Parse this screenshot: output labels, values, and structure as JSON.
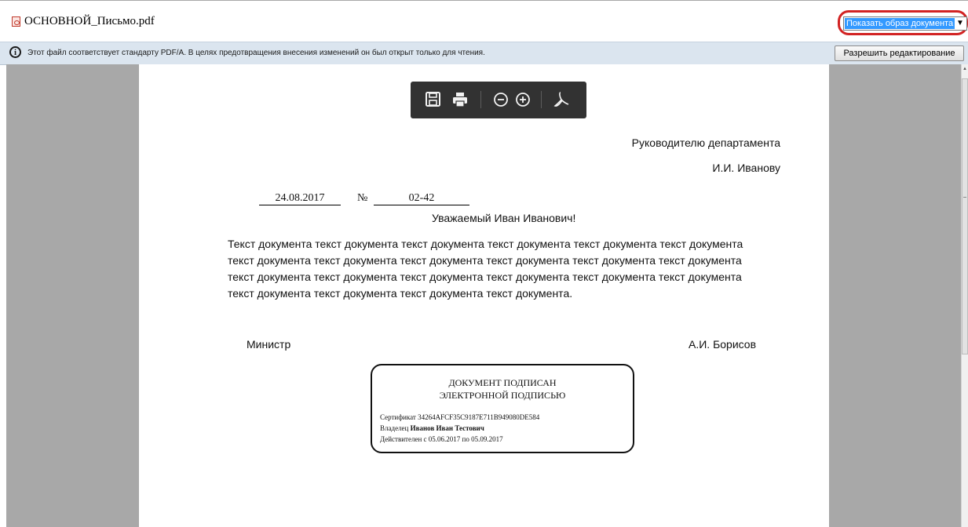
{
  "window": {
    "file_title": "ОСНОВНОЙ_Письмо.pdf",
    "view_mode_selected": "Показать образ документа"
  },
  "infobar": {
    "message": "Этот файл соответствует стандарту PDF/A. В целях предотвращения внесения изменений он был открыт только для чтения.",
    "enable_editing_label": "Разрешить редактирование"
  },
  "pdf_toolbar": {
    "buttons": [
      "save-icon",
      "print-icon",
      "zoom-out-icon",
      "zoom-in-icon",
      "acrobat-icon"
    ]
  },
  "document": {
    "addressee_line1": "Руководителю департамента",
    "addressee_line2": "И.И. Иванову",
    "reg_date": "24.08.2017",
    "reg_number_label": "№",
    "reg_number": "02-42",
    "greeting": "Уважаемый Иван Иванович!",
    "body_lines": [
      "Текст документа текст документа текст документа текст документа текст документа текст документа",
      "текст документа текст документа текст документа текст документа текст документа текст документа",
      "текст документа текст документа текст документа текст документа текст документа текст документа",
      "текст документа текст документа текст документа текст документа."
    ],
    "signer_position": "Министр",
    "signer_name": "А.И. Борисов"
  },
  "signature_stamp": {
    "title_line1": "ДОКУМЕНТ ПОДПИСАН",
    "title_line2": "ЭЛЕКТРОННОЙ ПОДПИСЬЮ",
    "certificate_label": "Сертификат",
    "certificate_value": "34264AFCF35C9187E711B949080DE584",
    "owner_label": "Владелец",
    "owner_value": "Иванов Иван Тестович",
    "validity_label": "Действителен",
    "validity_value": "с 05.06.2017 по 05.09.2017"
  },
  "colors": {
    "highlight_outline": "#d22323",
    "selection_blue": "#3399ff",
    "infobar_bg": "#dbe5ef",
    "viewer_bg": "#a8a8a8",
    "toolbar_bg": "#323232"
  }
}
